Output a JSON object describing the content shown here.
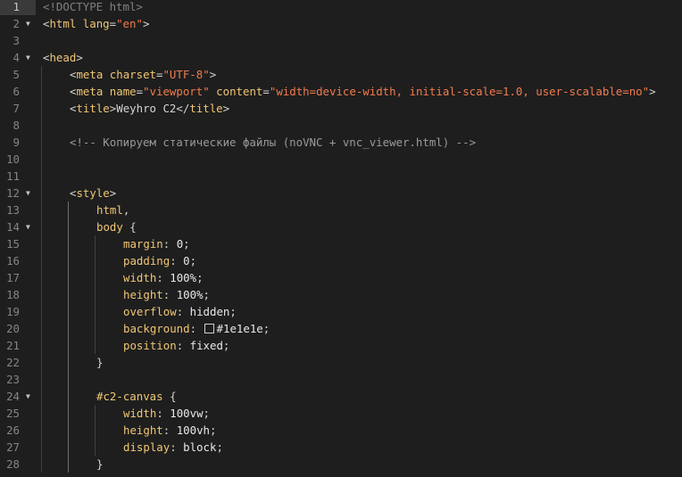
{
  "editor": {
    "background": "#1e1e1e",
    "active_line": 1,
    "lines": [
      {
        "n": "1",
        "fold": false,
        "indent": 0,
        "tokens": [
          [
            "t-doctype",
            "<!DOCTYPE html>"
          ]
        ]
      },
      {
        "n": "2",
        "fold": true,
        "indent": 0,
        "tokens": [
          [
            "t-bracket",
            "<"
          ],
          [
            "t-tag",
            "html"
          ],
          [
            "t-text",
            " "
          ],
          [
            "t-attr",
            "lang"
          ],
          [
            "t-text",
            "="
          ],
          [
            "t-str",
            "\"en\""
          ],
          [
            "t-bracket",
            ">"
          ]
        ]
      },
      {
        "n": "3",
        "fold": false,
        "indent": 0,
        "tokens": []
      },
      {
        "n": "4",
        "fold": true,
        "indent": 0,
        "tokens": [
          [
            "t-bracket",
            "<"
          ],
          [
            "t-tag",
            "head"
          ],
          [
            "t-bracket",
            ">"
          ]
        ]
      },
      {
        "n": "5",
        "fold": false,
        "indent": 1,
        "tokens": [
          [
            "t-bracket",
            "<"
          ],
          [
            "t-tag",
            "meta"
          ],
          [
            "t-text",
            " "
          ],
          [
            "t-attr",
            "charset"
          ],
          [
            "t-text",
            "="
          ],
          [
            "t-str",
            "\"UTF-8\""
          ],
          [
            "t-bracket",
            ">"
          ]
        ]
      },
      {
        "n": "6",
        "fold": false,
        "indent": 1,
        "tokens": [
          [
            "t-bracket",
            "<"
          ],
          [
            "t-tag",
            "meta"
          ],
          [
            "t-text",
            " "
          ],
          [
            "t-attr",
            "name"
          ],
          [
            "t-text",
            "="
          ],
          [
            "t-str",
            "\"viewport\""
          ],
          [
            "t-text",
            " "
          ],
          [
            "t-attr",
            "content"
          ],
          [
            "t-text",
            "="
          ],
          [
            "t-str",
            "\"width=device-width, initial-scale=1.0, user-scalable=no\""
          ],
          [
            "t-bracket",
            ">"
          ]
        ]
      },
      {
        "n": "7",
        "fold": false,
        "indent": 1,
        "tokens": [
          [
            "t-bracket",
            "<"
          ],
          [
            "t-tag",
            "title"
          ],
          [
            "t-bracket",
            ">"
          ],
          [
            "t-text",
            "Weyhro C2"
          ],
          [
            "t-bracket",
            "</"
          ],
          [
            "t-tag",
            "title"
          ],
          [
            "t-bracket",
            ">"
          ]
        ]
      },
      {
        "n": "8",
        "fold": false,
        "indent": 1,
        "tokens": []
      },
      {
        "n": "9",
        "fold": false,
        "indent": 1,
        "tokens": [
          [
            "t-comment",
            "<!-- Копируем статические файлы (noVNC + vnc_viewer.html) -->"
          ]
        ]
      },
      {
        "n": "10",
        "fold": false,
        "indent": 1,
        "tokens": []
      },
      {
        "n": "11",
        "fold": false,
        "indent": 1,
        "tokens": []
      },
      {
        "n": "12",
        "fold": true,
        "indent": 1,
        "tokens": [
          [
            "t-bracket",
            "<"
          ],
          [
            "t-tag",
            "style"
          ],
          [
            "t-bracket",
            ">"
          ]
        ]
      },
      {
        "n": "13",
        "fold": false,
        "indent": 2,
        "tokens": [
          [
            "t-sel",
            "html"
          ],
          [
            "t-text",
            ","
          ]
        ]
      },
      {
        "n": "14",
        "fold": true,
        "indent": 2,
        "tokens": [
          [
            "t-sel",
            "body"
          ],
          [
            "t-text",
            " {"
          ]
        ]
      },
      {
        "n": "15",
        "fold": false,
        "indent": 3,
        "tokens": [
          [
            "t-prop",
            "margin"
          ],
          [
            "t-text",
            ": "
          ],
          [
            "t-val",
            "0"
          ],
          [
            "t-text",
            ";"
          ]
        ]
      },
      {
        "n": "16",
        "fold": false,
        "indent": 3,
        "tokens": [
          [
            "t-prop",
            "padding"
          ],
          [
            "t-text",
            ": "
          ],
          [
            "t-val",
            "0"
          ],
          [
            "t-text",
            ";"
          ]
        ]
      },
      {
        "n": "17",
        "fold": false,
        "indent": 3,
        "tokens": [
          [
            "t-prop",
            "width"
          ],
          [
            "t-text",
            ": "
          ],
          [
            "t-val",
            "100%"
          ],
          [
            "t-text",
            ";"
          ]
        ]
      },
      {
        "n": "18",
        "fold": false,
        "indent": 3,
        "tokens": [
          [
            "t-prop",
            "height"
          ],
          [
            "t-text",
            ": "
          ],
          [
            "t-val",
            "100%"
          ],
          [
            "t-text",
            ";"
          ]
        ]
      },
      {
        "n": "19",
        "fold": false,
        "indent": 3,
        "tokens": [
          [
            "t-prop",
            "overflow"
          ],
          [
            "t-text",
            ": "
          ],
          [
            "t-val",
            "hidden"
          ],
          [
            "t-text",
            ";"
          ]
        ]
      },
      {
        "n": "20",
        "fold": false,
        "indent": 3,
        "tokens": [
          [
            "t-prop",
            "background"
          ],
          [
            "t-text",
            ": "
          ],
          [
            "swatch",
            ""
          ],
          [
            "t-val",
            "#1e1e1e"
          ],
          [
            "t-text",
            ";"
          ]
        ]
      },
      {
        "n": "21",
        "fold": false,
        "indent": 3,
        "tokens": [
          [
            "t-prop",
            "position"
          ],
          [
            "t-text",
            ": "
          ],
          [
            "t-val",
            "fixed"
          ],
          [
            "t-text",
            ";"
          ]
        ]
      },
      {
        "n": "22",
        "fold": false,
        "indent": 2,
        "tokens": [
          [
            "t-text",
            "}"
          ]
        ]
      },
      {
        "n": "23",
        "fold": false,
        "indent": 2,
        "tokens": []
      },
      {
        "n": "24",
        "fold": true,
        "indent": 2,
        "tokens": [
          [
            "t-sel",
            "#c2-canvas"
          ],
          [
            "t-text",
            " {"
          ]
        ]
      },
      {
        "n": "25",
        "fold": false,
        "indent": 3,
        "tokens": [
          [
            "t-prop",
            "width"
          ],
          [
            "t-text",
            ": "
          ],
          [
            "t-val",
            "100vw"
          ],
          [
            "t-text",
            ";"
          ]
        ]
      },
      {
        "n": "26",
        "fold": false,
        "indent": 3,
        "tokens": [
          [
            "t-prop",
            "height"
          ],
          [
            "t-text",
            ": "
          ],
          [
            "t-val",
            "100vh"
          ],
          [
            "t-text",
            ";"
          ]
        ]
      },
      {
        "n": "27",
        "fold": false,
        "indent": 3,
        "tokens": [
          [
            "t-prop",
            "display"
          ],
          [
            "t-text",
            ": "
          ],
          [
            "t-val",
            "block"
          ],
          [
            "t-text",
            ";"
          ]
        ]
      },
      {
        "n": "28",
        "fold": false,
        "indent": 2,
        "tokens": [
          [
            "t-text",
            "}"
          ]
        ]
      }
    ]
  }
}
